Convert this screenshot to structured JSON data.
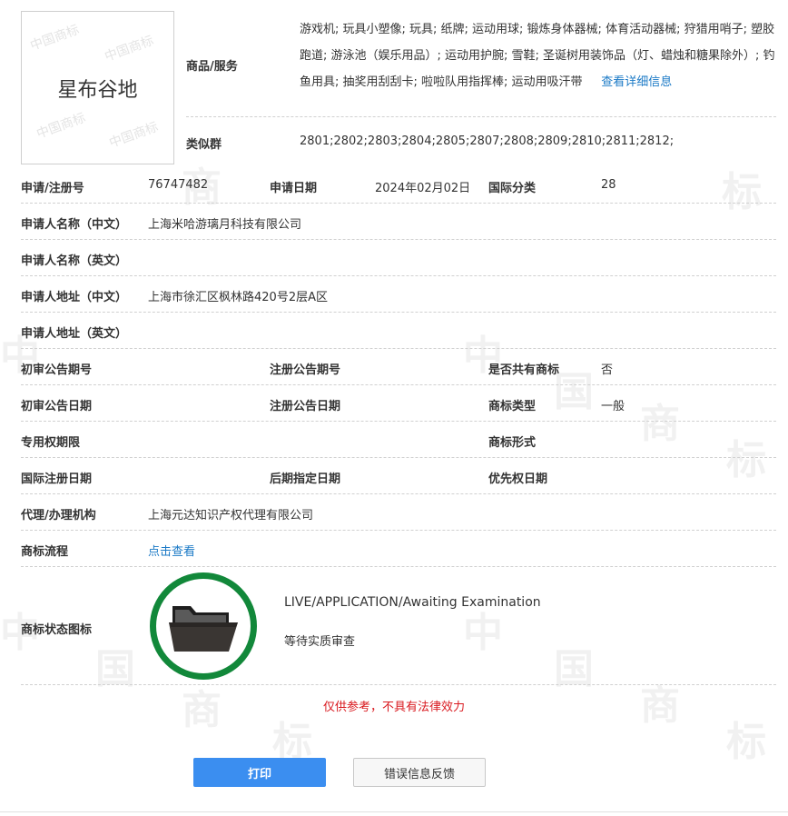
{
  "logo": {
    "text": "星布谷地",
    "watermark": "中国商标"
  },
  "goods": {
    "label": "商品/服务",
    "text": "游戏机; 玩具小塑像; 玩具; 纸牌; 运动用球; 锻炼身体器械; 体育活动器械; 狩猎用哨子; 塑胶跑道; 游泳池（娱乐用品）; 运动用护腕; 雪鞋; 圣诞树用装饰品（灯、蜡烛和糖果除外）; 钓鱼用具; 抽奖用刮刮卡; 啦啦队用指挥棒; 运动用吸汗带",
    "detail_link": "查看详细信息"
  },
  "similar_group": {
    "label": "类似群",
    "value": "2801;2802;2803;2804;2805;2807;2808;2809;2810;2811;2812;"
  },
  "fields": {
    "reg_no_label": "申请/注册号",
    "reg_no": "76747482",
    "app_date_label": "申请日期",
    "app_date": "2024年02月02日",
    "intl_class_label": "国际分类",
    "intl_class": "28",
    "applicant_cn_label": "申请人名称（中文）",
    "applicant_cn": "上海米哈游璃月科技有限公司",
    "applicant_en_label": "申请人名称（英文）",
    "applicant_en": "",
    "address_cn_label": "申请人地址（中文）",
    "address_cn": "上海市徐汇区枫林路420号2层A区",
    "address_en_label": "申请人地址（英文）",
    "address_en": "",
    "prelim_no_label": "初审公告期号",
    "prelim_no": "",
    "reg_pub_no_label": "注册公告期号",
    "reg_pub_no": "",
    "shared_label": "是否共有商标",
    "shared": "否",
    "prelim_date_label": "初审公告日期",
    "prelim_date": "",
    "reg_pub_date_label": "注册公告日期",
    "reg_pub_date": "",
    "tm_type_label": "商标类型",
    "tm_type": "一般",
    "exclusive_label": "专用权期限",
    "exclusive": "",
    "tm_form_label": "商标形式",
    "tm_form": "",
    "intl_reg_date_label": "国际注册日期",
    "intl_reg_date": "",
    "later_date_label": "后期指定日期",
    "later_date": "",
    "priority_date_label": "优先权日期",
    "priority_date": "",
    "agent_label": "代理/办理机构",
    "agent": "上海元达知识产权代理有限公司",
    "process_label": "商标流程",
    "process_link": "点击查看",
    "status_icon_label": "商标状态图标"
  },
  "status": {
    "en": "LIVE/APPLICATION/Awaiting Examination",
    "cn": "等待实质审查",
    "icon": "folder-icon",
    "ring_color": "#12883a"
  },
  "disclaimer": "仅供参考，不具有法律效力",
  "buttons": {
    "print": "打印",
    "feedback": "错误信息反馈"
  },
  "colors": {
    "link": "#1a79c6",
    "primary_button": "#3b8ef0",
    "disclaimer": "#d9191f"
  }
}
